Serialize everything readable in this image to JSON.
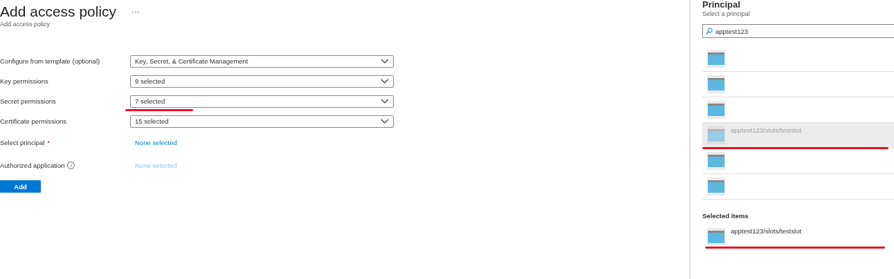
{
  "page": {
    "title": "Add access policy",
    "more": "···",
    "subtitle": "Add access policy"
  },
  "form": [
    {
      "kind": "dropdown",
      "label": "Configure from template (optional)",
      "value": "Key, Secret, & Certificate Management",
      "underlined": false
    },
    {
      "kind": "dropdown",
      "label": "Key permissions",
      "value": "9 selected",
      "underlined": false
    },
    {
      "kind": "dropdown",
      "label": "Secret permissions",
      "value": "7 selected",
      "underlined": true
    },
    {
      "kind": "dropdown",
      "label": "Certificate permissions",
      "value": "15 selected",
      "underlined": false
    },
    {
      "kind": "link",
      "label": "Select principal",
      "required": "*",
      "value": "None selected",
      "disabled": false
    },
    {
      "kind": "link",
      "label": "Authorized application",
      "info": "i",
      "value": "None selected",
      "disabled": true
    }
  ],
  "add_button": "Add",
  "panel": {
    "title": "Principal",
    "subtitle": "Select a principal",
    "search": "apptest123",
    "results": [
      {
        "selected": false,
        "underlined": false
      },
      {
        "selected": false,
        "underlined": false
      },
      {
        "selected": false,
        "underlined": false
      },
      {
        "selected": true,
        "name": "apptest123/slots/testslot",
        "underlined": true
      },
      {
        "selected": false,
        "underlined": false
      },
      {
        "selected": false,
        "underlined": false
      }
    ],
    "selected_heading": "Selected items",
    "selected_items": [
      {
        "name": "apptest123/slots/testslot",
        "underlined": true
      }
    ]
  }
}
